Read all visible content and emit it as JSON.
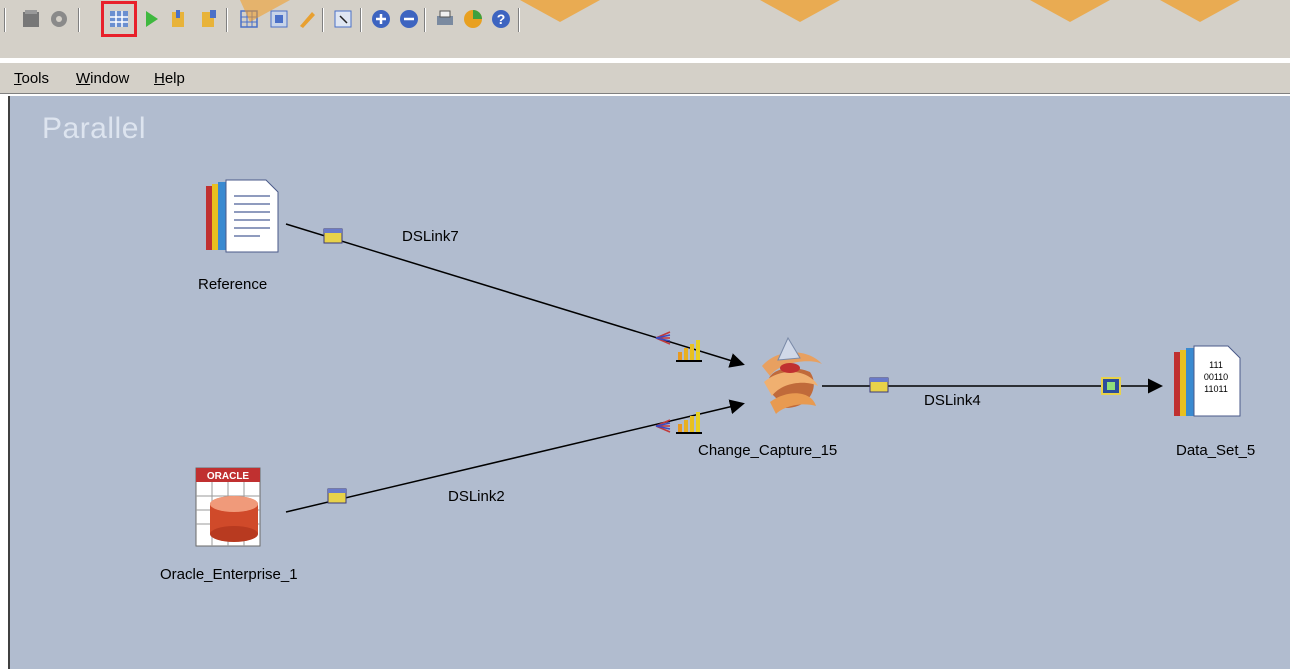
{
  "toolbar": {
    "highlighted_button": "job-properties-button"
  },
  "menu": {
    "items": [
      {
        "label": "Tools",
        "underline": "T",
        "rest": "ools"
      },
      {
        "label": "Window",
        "underline": "W",
        "rest": "indow"
      },
      {
        "label": "Help",
        "underline": "H",
        "rest": "elp"
      }
    ]
  },
  "canvas": {
    "title": "Parallel",
    "background_color": "#b1bccf"
  },
  "stages": {
    "reference": "Reference",
    "oracle": "Oracle_Enterprise_1",
    "oracle_badge": "ORACLE",
    "change_capture": "Change_Capture_15",
    "data_set": "Data_Set_5",
    "data_set_bits": [
      "111",
      "00110",
      "11011"
    ]
  },
  "links": {
    "dslink7": "DSLink7",
    "dslink2": "DSLink2",
    "dslink4": "DSLink4"
  }
}
